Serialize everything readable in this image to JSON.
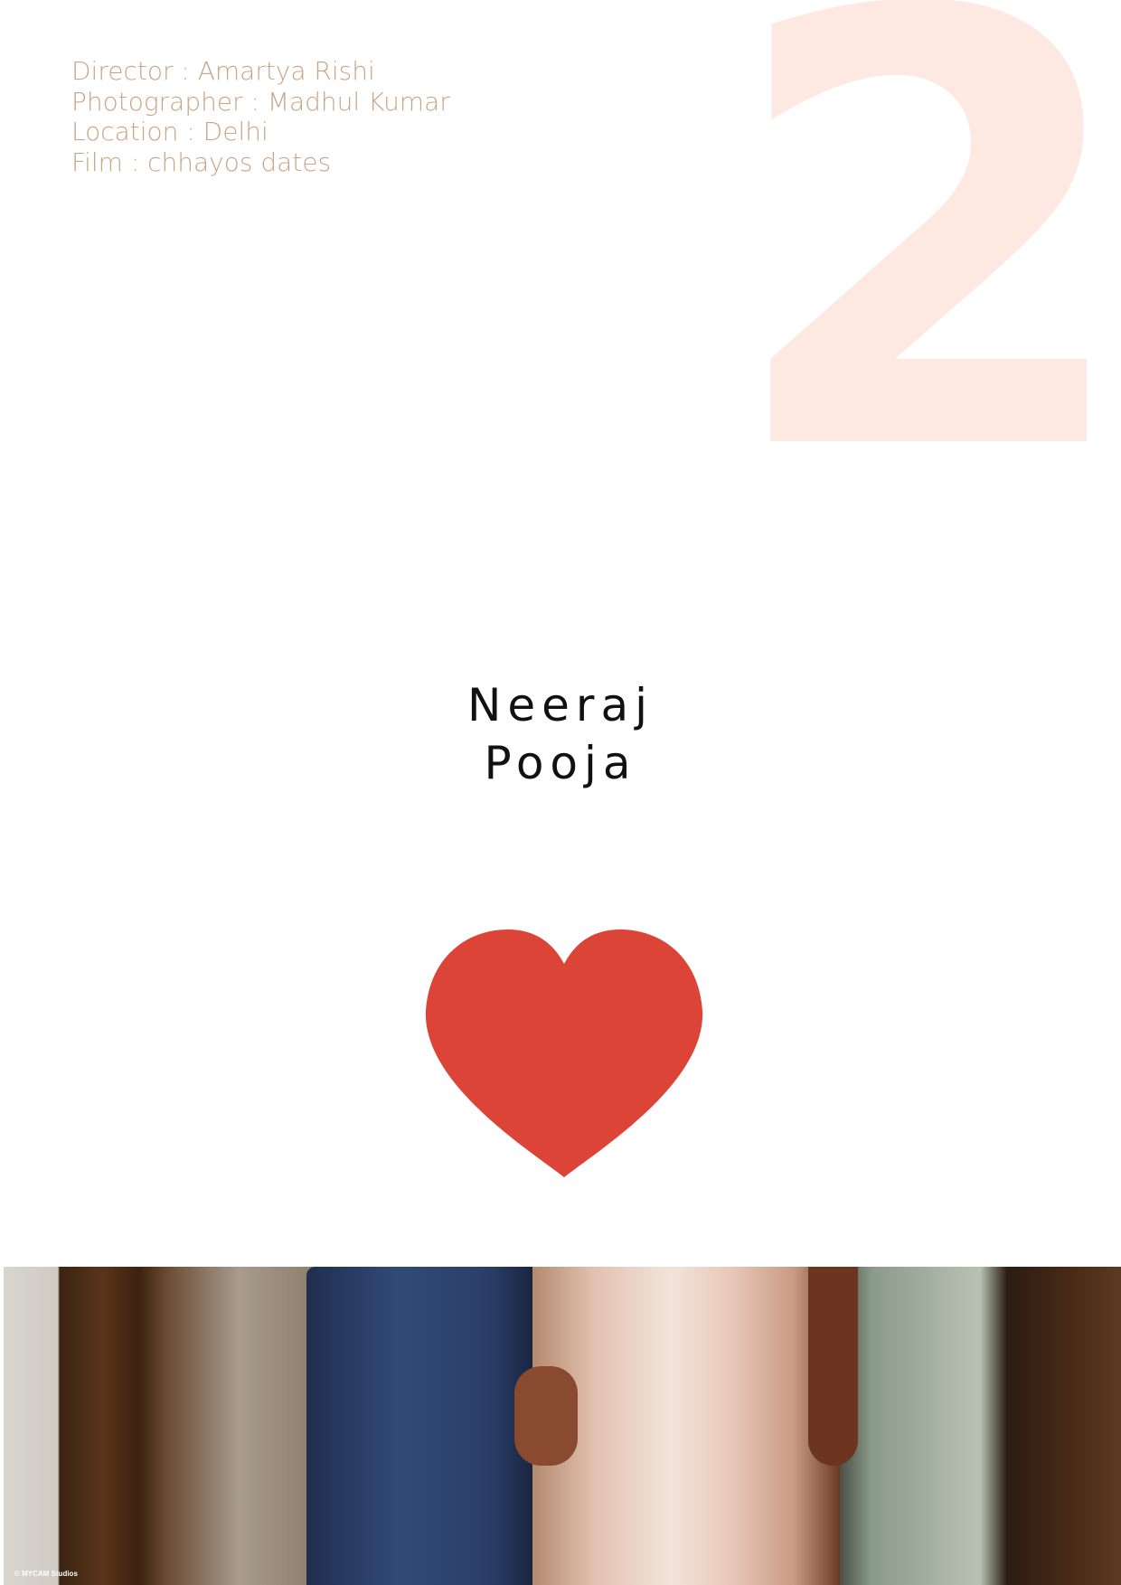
{
  "credits": {
    "director": "Director : Amartya Rishi",
    "photographer": "Photographer : Madhul Kumar",
    "location": "Location : Delhi",
    "film": "Film : chhayos dates"
  },
  "page_number": "2",
  "couple": {
    "name1": "Neeraj",
    "name2": "Pooja"
  },
  "photo": {
    "copyright": "© MYCAM Studios"
  },
  "colors": {
    "credit_text": "#c9a587",
    "number": "#fde9e1",
    "heart": "#dc4437"
  }
}
